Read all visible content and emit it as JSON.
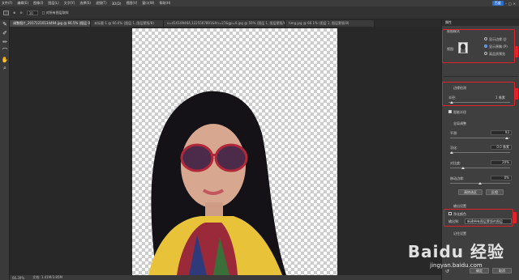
{
  "menubar": {
    "items": [
      "文件(F)",
      "编辑(E)",
      "图像(I)",
      "图层(L)",
      "文字(Y)",
      "选择(S)",
      "滤镜(T)",
      "3D(D)",
      "视图(V)",
      "窗口(W)",
      "帮助(H)"
    ],
    "badge": "百度"
  },
  "options": {
    "brush_size": "10",
    "checkbox_label": "□ 对所有图层取样"
  },
  "tabs": [
    {
      "label": "调整图片_20171210134494.jpg @ 66.5% (图层 0, RGB/8) *"
    },
    {
      "label": "未标题-1 @ 66.6% (图层 1, 图层蒙版/8)"
    },
    {
      "label": "u=416189464,1225567891&fm=27&gp=0.jpg @ 50% (图层 1, 图层蒙版/8)"
    },
    {
      "label": "timg.jpg @ 66.1% (图层 1, 图层蒙版/8)"
    }
  ],
  "status": {
    "zoom": "66.39%",
    "doc": "文档: 1.41M/3.85M"
  },
  "panel": {
    "title": "属性",
    "view_mode_title": "视图模式",
    "view_label": "视图:",
    "show_edge": "显示边缘 (J)",
    "show_original": "显示原稿 (P)",
    "hq_preview": "高品质预览",
    "edge_detect_title": "边缘检测",
    "radius_label": "半径:",
    "radius_value": "1 像素",
    "smart_radius": "智能半径",
    "global_title": "全局调整",
    "smooth_label": "平滑:",
    "smooth_value": "93",
    "feather_label": "羽化:",
    "feather_value": "0.0 像素",
    "contrast_label": "对比度:",
    "contrast_value": "20%",
    "shift_label": "移动边缘:",
    "shift_value": "0%",
    "clear_btn": "清除选区",
    "invert_btn": "反相",
    "output_title": "输出设置",
    "decontam_label": "净化颜色",
    "output_to_label": "输出到:",
    "output_to_value": "新建带有图层蒙版的图层",
    "remember_label": "记住设置",
    "ok_btn": "确定",
    "cancel_btn": "取消"
  },
  "watermark": {
    "brand": "Baidu 经验",
    "url": "jingyan.baidu.com"
  },
  "colors": {
    "highlight": "#e0232a"
  }
}
